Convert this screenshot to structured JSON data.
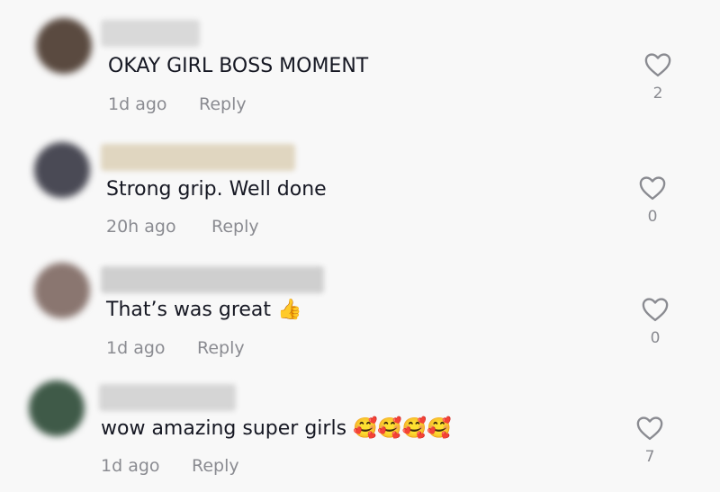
{
  "comments": [
    {
      "text": "OKAY GIRL BOSS MOMENT",
      "time": "1d ago",
      "reply": "Reply",
      "likes": "2",
      "avatar_color": "#5a4a40",
      "username_color": "#d9d9d9"
    },
    {
      "text": "Strong grip. Well done",
      "time": "20h ago",
      "reply": "Reply",
      "likes": "0",
      "avatar_color": "#4a4a55",
      "username_color": "#e0d6c0"
    },
    {
      "text": "That’s was great 👍",
      "time": "1d ago",
      "reply": "Reply",
      "likes": "0",
      "avatar_color": "#8a7670",
      "username_color": "#cfcfcf"
    },
    {
      "text": "wow amazing super girls 🥰🥰🥰🥰",
      "time": "1d ago",
      "reply": "Reply",
      "likes": "7",
      "avatar_color": "#3f5a48",
      "username_color": "#d5d5d5"
    }
  ],
  "icons": {
    "like": "heart-outline-icon"
  },
  "colors": {
    "background": "#f8f8f8",
    "text": "#161823",
    "secondary": "#8a8b91"
  }
}
